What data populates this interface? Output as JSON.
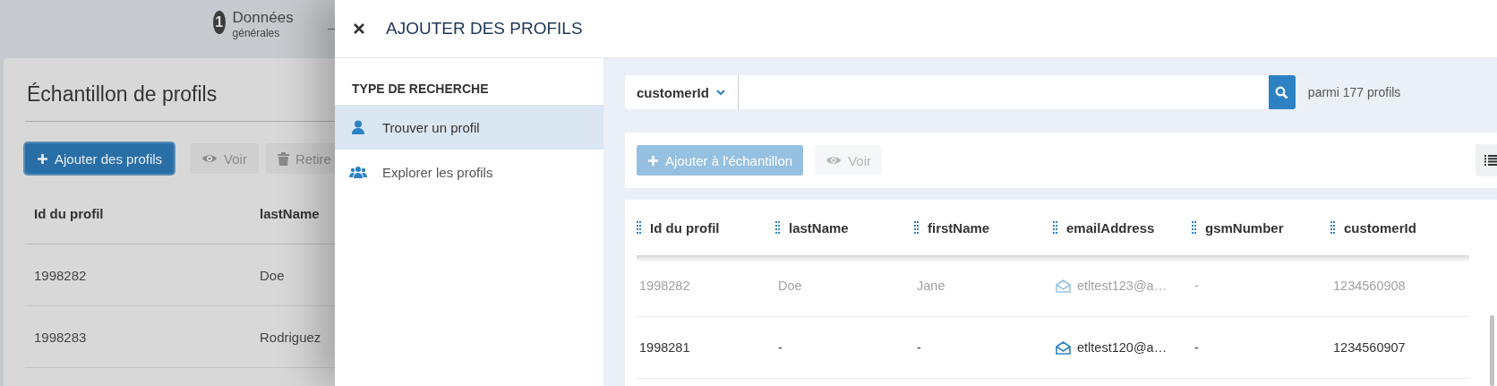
{
  "background_page": {
    "stepper": {
      "number": "1",
      "label": "Données",
      "sublabel": "générales"
    },
    "title": "Échantillon de profils",
    "buttons": [
      {
        "label": "Ajouter des profils",
        "kind": "add",
        "disabled": false
      },
      {
        "label": "Voir",
        "kind": "view",
        "disabled": true
      },
      {
        "label": "Retire",
        "kind": "delete",
        "disabled": true
      }
    ],
    "table": {
      "columns": [
        "Id du profil",
        "lastName"
      ],
      "rows": [
        [
          "1998282",
          "Doe"
        ],
        [
          "1998283",
          "Rodriguez"
        ]
      ]
    }
  },
  "dialog": {
    "title": "AJOUTER DES PROFILS",
    "sidebar": {
      "heading": "TYPE DE RECHERCHE",
      "items": [
        {
          "label": "Trouver un profil",
          "kind": "user",
          "selected": true
        },
        {
          "label": "Explorer les profils",
          "kind": "users",
          "selected": false
        }
      ]
    },
    "search": {
      "field": "customerId",
      "count": "parmi 177 profils"
    },
    "toolbar": {
      "buttons": [
        {
          "label": "Ajouter à l'échantillon",
          "kind": "add",
          "disabled": true
        },
        {
          "label": "Voir",
          "kind": "view",
          "disabled": true
        }
      ]
    },
    "table": {
      "columns": [
        {
          "label": "Id du profil",
          "kind": "text"
        },
        {
          "label": "lastName",
          "kind": "text"
        },
        {
          "label": "firstName",
          "kind": "text"
        },
        {
          "label": "emailAddress",
          "kind": "email"
        },
        {
          "label": "gsmNumber",
          "kind": "text"
        },
        {
          "label": "customerId",
          "kind": "text"
        }
      ],
      "rows": [
        {
          "cells": [
            "1998282",
            "Doe",
            "Jane",
            "etltest123@a…",
            "-",
            "1234560908"
          ],
          "disabled": true
        },
        {
          "cells": [
            "1998281",
            "-",
            "-",
            "etltest120@a…",
            "-",
            "1234560907"
          ],
          "disabled": false
        }
      ]
    }
  }
}
